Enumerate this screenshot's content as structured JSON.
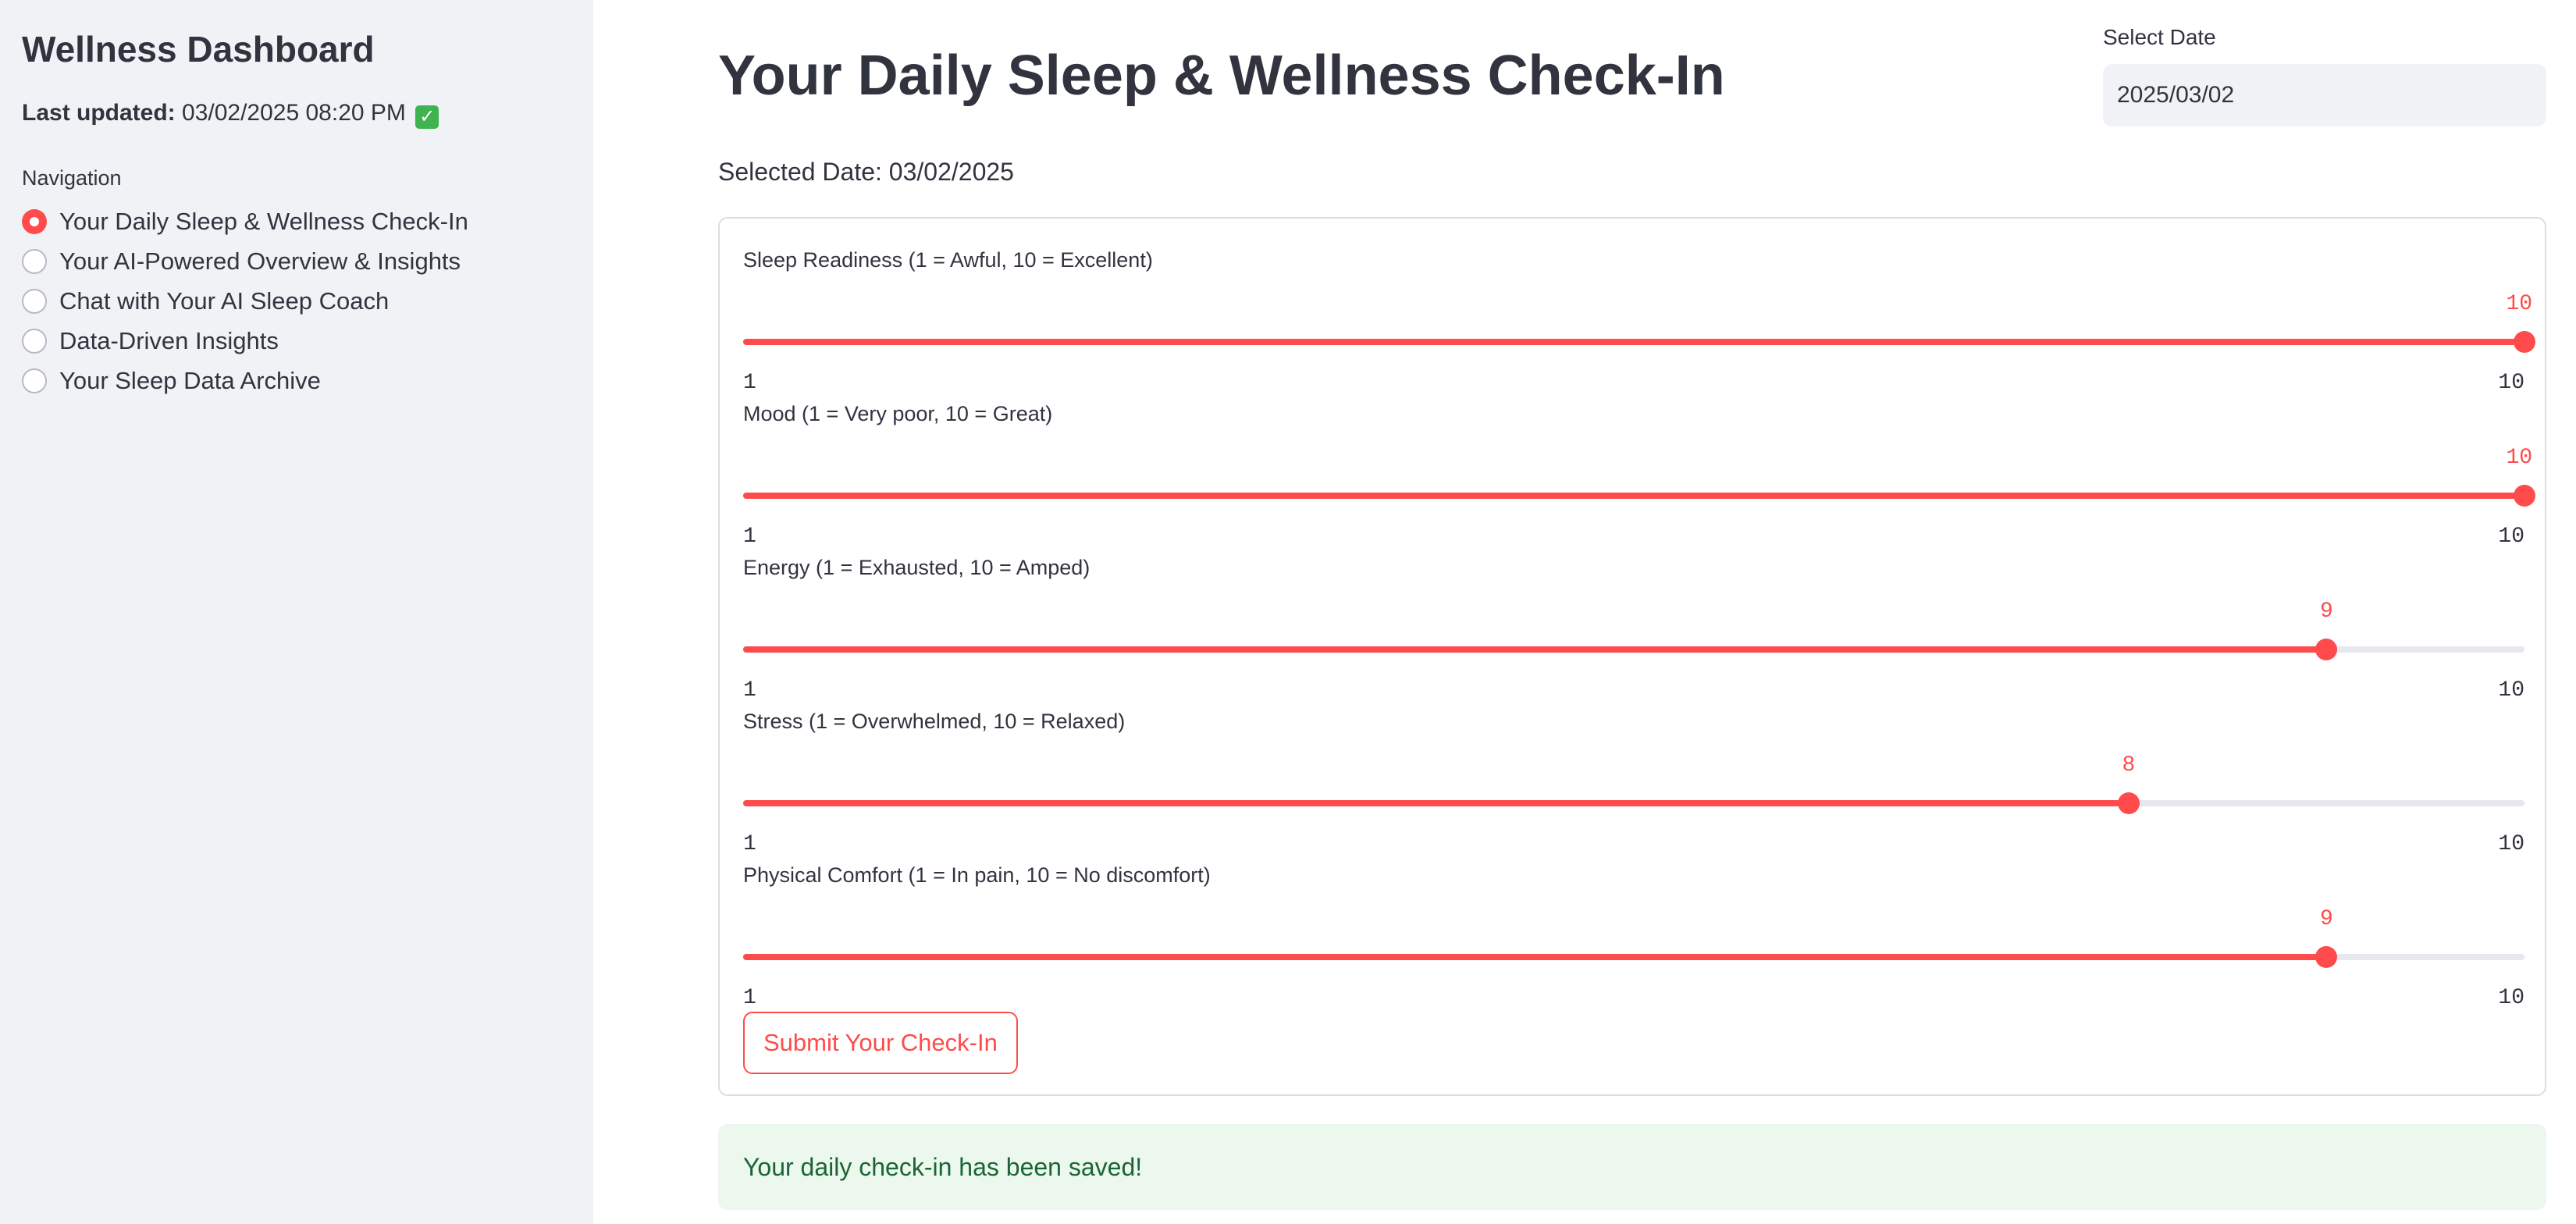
{
  "sidebar": {
    "title": "Wellness Dashboard",
    "last_updated_label": "Last updated:",
    "last_updated_value": "03/02/2025 08:20 PM",
    "nav_label": "Navigation",
    "items": [
      {
        "label": "Your Daily Sleep & Wellness Check-In",
        "selected": true
      },
      {
        "label": "Your AI-Powered Overview & Insights",
        "selected": false
      },
      {
        "label": "Chat with Your AI Sleep Coach",
        "selected": false
      },
      {
        "label": "Data-Driven Insights",
        "selected": false
      },
      {
        "label": "Your Sleep Data Archive",
        "selected": false
      }
    ]
  },
  "header": {
    "title": "Your Daily Sleep & Wellness Check-In",
    "date_label": "Select Date",
    "date_value": "2025/03/02"
  },
  "selected_date_text": "Selected Date: 03/02/2025",
  "sliders": [
    {
      "label": "Sleep Readiness (1 = Awful, 10 = Excellent)",
      "value": "10",
      "min": "1",
      "max": "10"
    },
    {
      "label": "Mood (1 = Very poor, 10 = Great)",
      "value": "10",
      "min": "1",
      "max": "10"
    },
    {
      "label": "Energy (1 = Exhausted, 10 = Amped)",
      "value": "9",
      "min": "1",
      "max": "10"
    },
    {
      "label": "Stress (1 = Overwhelmed, 10 = Relaxed)",
      "value": "8",
      "min": "1",
      "max": "10"
    },
    {
      "label": "Physical Comfort (1 = In pain, 10 = No discomfort)",
      "value": "9",
      "min": "1",
      "max": "10"
    }
  ],
  "submit_label": "Submit Your Check-In",
  "success_message": "Your daily check-in has been saved!",
  "colors": {
    "accent": "#ff4b4b",
    "sidebar_bg": "#f0f2f6",
    "success_bg": "#ecf7ee",
    "success_text": "#1b6535"
  },
  "icons": {
    "last_updated_status": "check-mark-emoji-icon"
  }
}
